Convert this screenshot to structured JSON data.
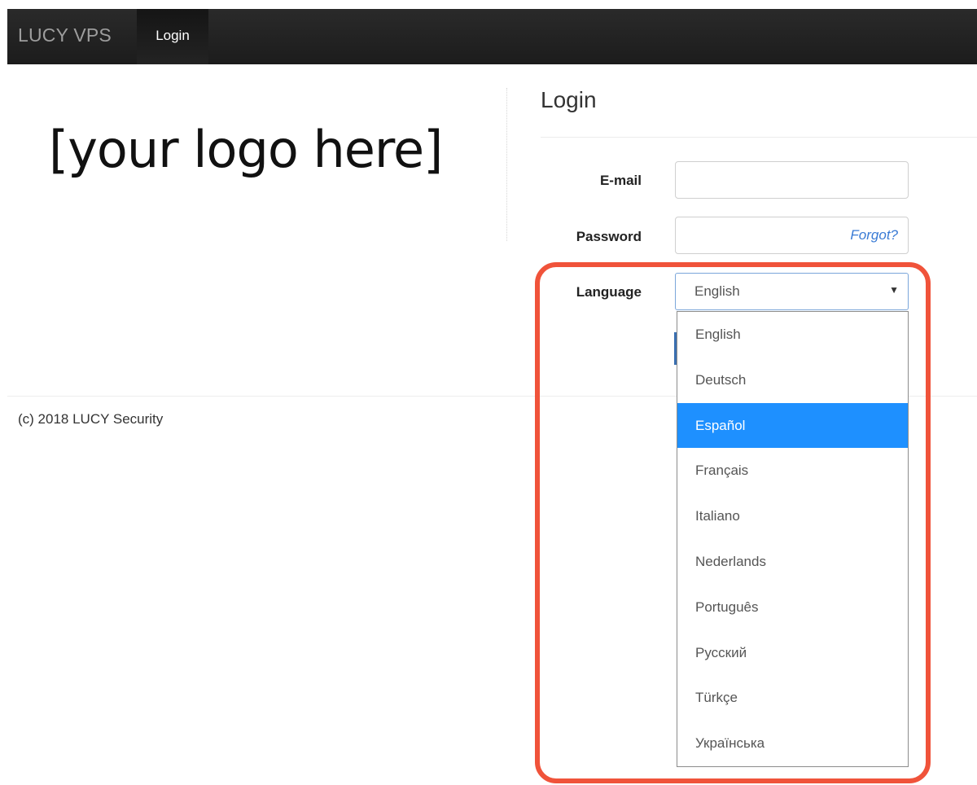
{
  "navbar": {
    "brand": "LUCY VPS",
    "active_item": "Login"
  },
  "logo_text": "[your logo here]",
  "login": {
    "title": "Login",
    "email_label": "E-mail",
    "email_value": "",
    "password_label": "Password",
    "password_value": "",
    "forgot_link": "Forgot?",
    "language_label": "Language",
    "language_selected": "English",
    "caret": "▼"
  },
  "language_options": [
    {
      "label": "English",
      "highlighted": false
    },
    {
      "label": "Deutsch",
      "highlighted": false
    },
    {
      "label": "Español",
      "highlighted": true
    },
    {
      "label": "Français",
      "highlighted": false
    },
    {
      "label": "Italiano",
      "highlighted": false
    },
    {
      "label": "Nederlands",
      "highlighted": false
    },
    {
      "label": "Português",
      "highlighted": false
    },
    {
      "label": "Русский",
      "highlighted": false
    },
    {
      "label": "Türkçe",
      "highlighted": false
    },
    {
      "label": "Українська",
      "highlighted": false
    }
  ],
  "footer": {
    "copyright": "(c) 2018 LUCY Security"
  },
  "colors": {
    "navbar": "#222222",
    "highlight_option": "#1e90ff",
    "annotation_outline": "#f0533a",
    "link": "#3a7bd5"
  }
}
